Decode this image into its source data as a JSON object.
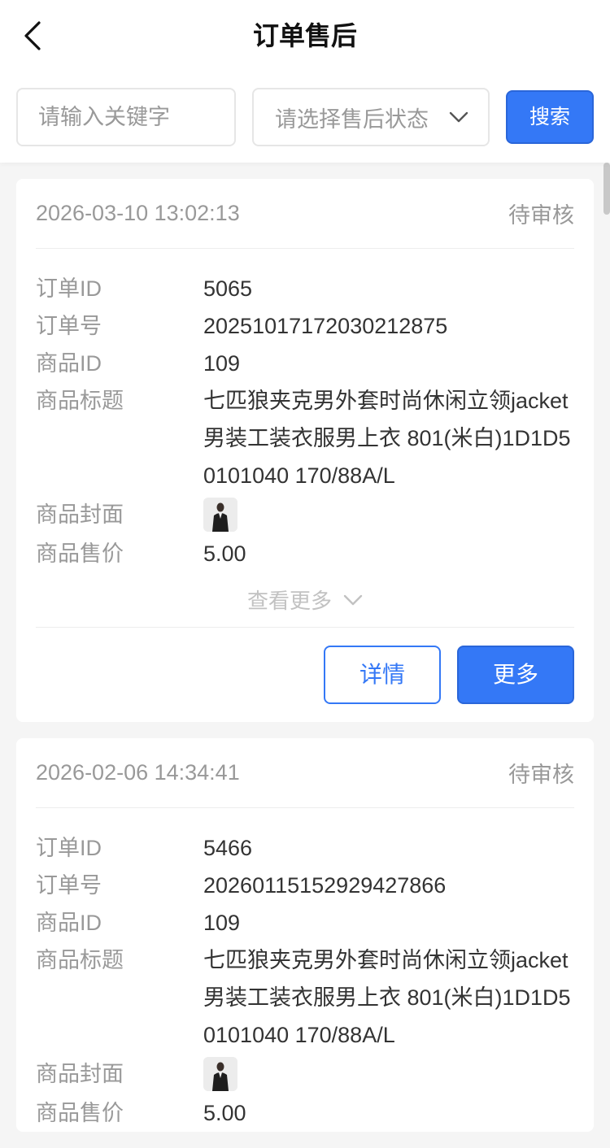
{
  "header": {
    "title": "订单售后",
    "back_icon": "chevron-left-icon"
  },
  "filters": {
    "keyword_placeholder": "请输入关键字",
    "keyword_value": "",
    "status_placeholder": "请选择售后状态",
    "status_icon": "chevron-down-icon",
    "search_label": "搜索"
  },
  "labels": {
    "order_id": "订单ID",
    "order_no": "订单号",
    "product_id": "商品ID",
    "product_title": "商品标题",
    "product_cover": "商品封面",
    "product_price": "商品售价",
    "view_more": "查看更多",
    "detail": "详情",
    "more": "更多"
  },
  "orders": [
    {
      "time": "2026-03-10 13:02:13",
      "status": "待审核",
      "order_id": "5065",
      "order_no": "20251017172030212875",
      "product_id": "109",
      "product_title": "七匹狼夹克男外套时尚休闲立领jacket男装工装衣服男上衣 801(米白)1D1D50101040 170/88A/L",
      "product_price": "5.00"
    },
    {
      "time": "2026-02-06 14:34:41",
      "status": "待审核",
      "order_id": "5466",
      "order_no": "20260115152929427866",
      "product_id": "109",
      "product_title": "七匹狼夹克男外套时尚休闲立领jacket男装工装衣服男上衣 801(米白)1D1D50101040 170/88A/L",
      "product_price": "5.00"
    }
  ],
  "colors": {
    "primary": "#3478f6",
    "background": "#f5f5f5",
    "muted_text": "#999999"
  }
}
